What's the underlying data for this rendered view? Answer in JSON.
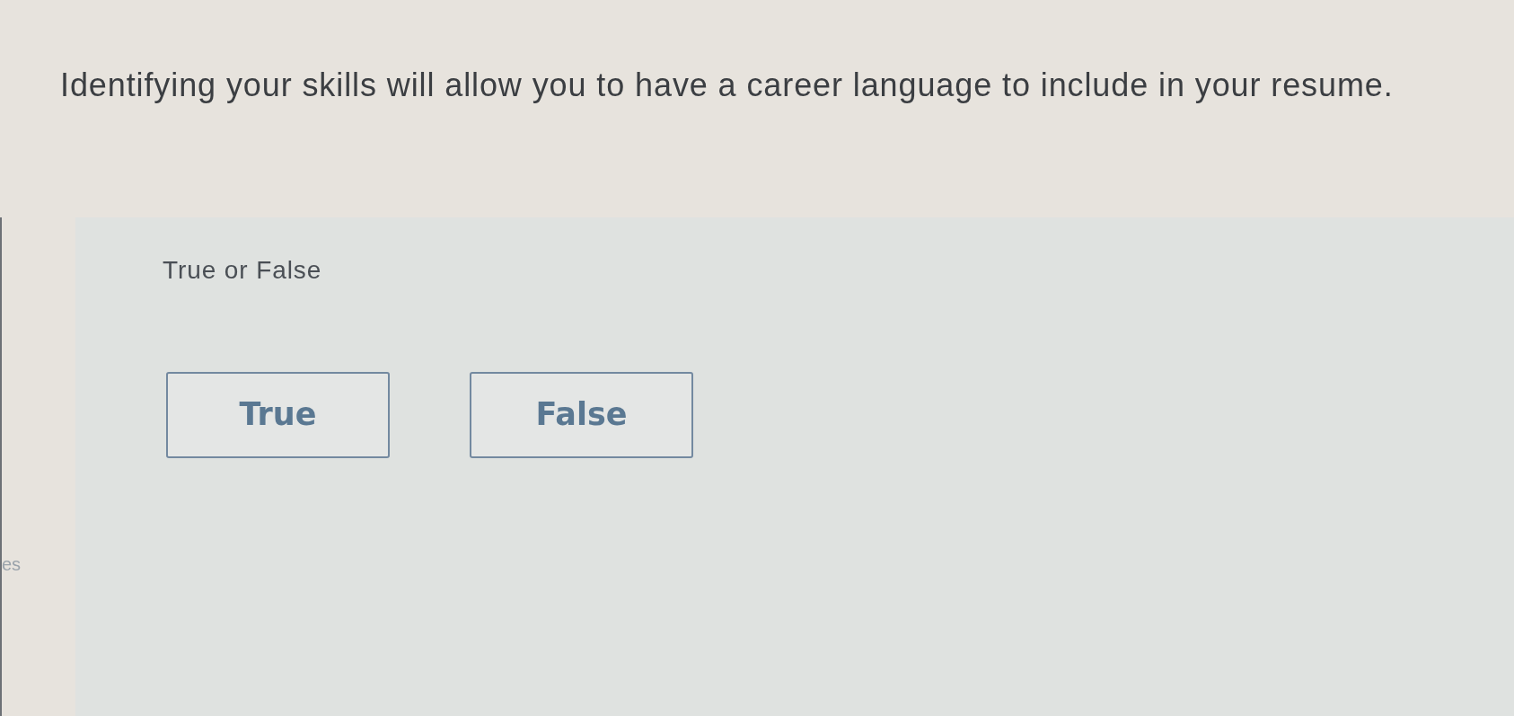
{
  "question": {
    "text": "Identifying your skills will allow you to have a career language to include in your resume."
  },
  "sidebar": {
    "text_fragment": "es"
  },
  "answer_panel": {
    "instruction": "True or False",
    "options": [
      {
        "label": "True",
        "selected": false
      },
      {
        "label": "False",
        "selected": false
      }
    ]
  }
}
